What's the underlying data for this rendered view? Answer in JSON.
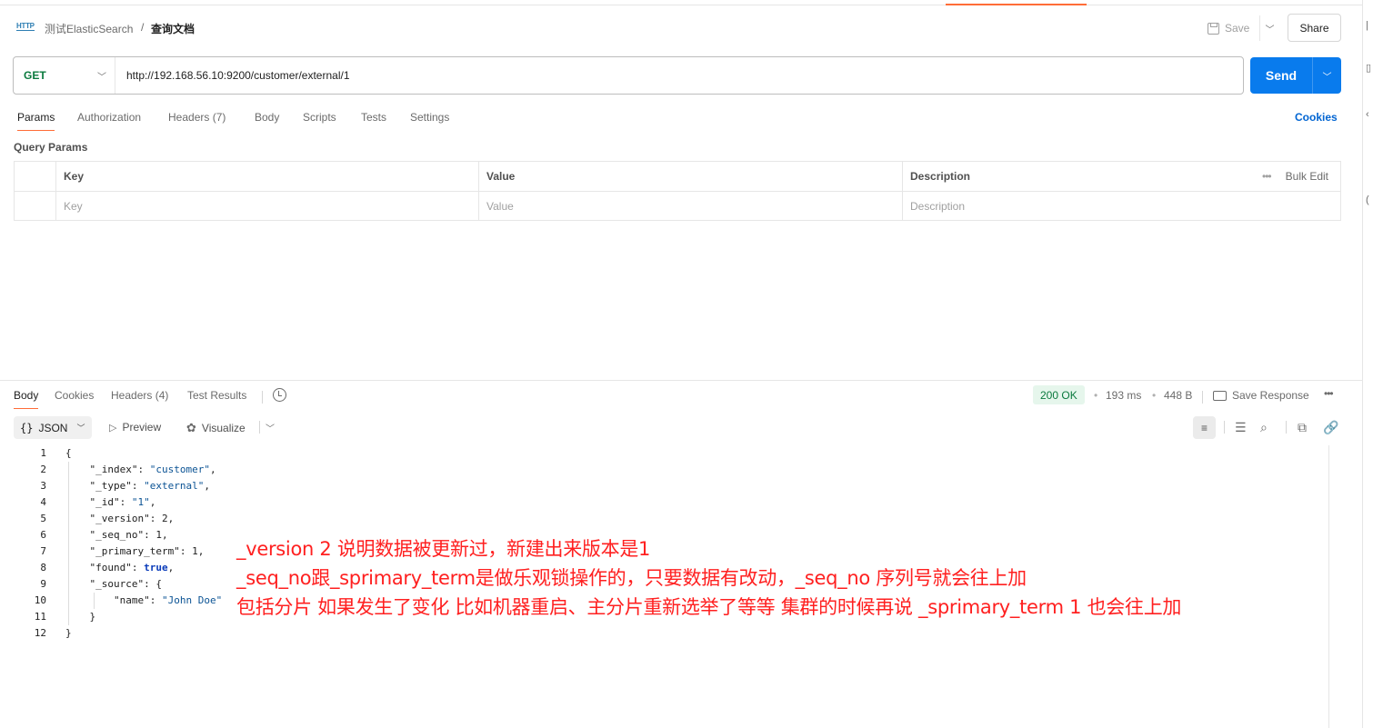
{
  "header": {
    "icon_label": "HTTP",
    "breadcrumb_parent": "测试ElasticSearch",
    "breadcrumb_separator": "/",
    "breadcrumb_current": "查询文档",
    "save_label": "Save",
    "share_label": "Share"
  },
  "request": {
    "method": "GET",
    "url": "http://192.168.56.10:9200/customer/external/1",
    "send_label": "Send"
  },
  "request_tabs": {
    "params": "Params",
    "authorization": "Authorization",
    "headers": "Headers",
    "headers_count": "(7)",
    "body": "Body",
    "scripts": "Scripts",
    "tests": "Tests",
    "settings": "Settings",
    "cookies": "Cookies"
  },
  "query_params": {
    "title": "Query Params",
    "columns": {
      "key": "Key",
      "value": "Value",
      "description": "Description"
    },
    "bulk_edit": "Bulk Edit",
    "placeholders": {
      "key": "Key",
      "value": "Value",
      "description": "Description"
    }
  },
  "response_tabs": {
    "body": "Body",
    "cookies": "Cookies",
    "headers": "Headers",
    "headers_count": "(4)",
    "test_results": "Test Results"
  },
  "response_meta": {
    "status": "200 OK",
    "time": "193 ms",
    "size": "448 B",
    "save_response": "Save Response"
  },
  "view_options": {
    "format": "JSON",
    "preview": "Preview",
    "visualize": "Visualize"
  },
  "response_body": {
    "line_numbers": [
      "1",
      "2",
      "3",
      "4",
      "5",
      "6",
      "7",
      "8",
      "9",
      "10",
      "11",
      "12"
    ],
    "index_key": "\"_index\"",
    "index_val": "\"customer\"",
    "type_key": "\"_type\"",
    "type_val": "\"external\"",
    "id_key": "\"_id\"",
    "id_val": "\"1\"",
    "version_key": "\"_version\"",
    "version_val": "2",
    "seq_key": "\"_seq_no\"",
    "seq_val": "1",
    "term_key": "\"_primary_term\"",
    "term_val": "1",
    "found_key": "\"found\"",
    "found_val": "true",
    "source_key": "\"_source\"",
    "name_key": "\"name\"",
    "name_val": "\"John Doe\""
  },
  "annotations": [
    "_version 2 说明数据被更新过，新建出来版本是1",
    "_seq_no跟_sprimary_term是做乐观锁操作的，只要数据有改动，_seq_no 序列号就会往上加",
    "包括分片 如果发生了变化 比如机器重启、主分片重新选举了等等 集群的时候再说 _sprimary_term 1 也会往上加"
  ],
  "colors": {
    "accent": "#ff6c37",
    "send": "#097bed",
    "get_method": "#0b7a3e",
    "status_ok_bg": "#e6f6ec",
    "annotation": "#ff2020"
  }
}
